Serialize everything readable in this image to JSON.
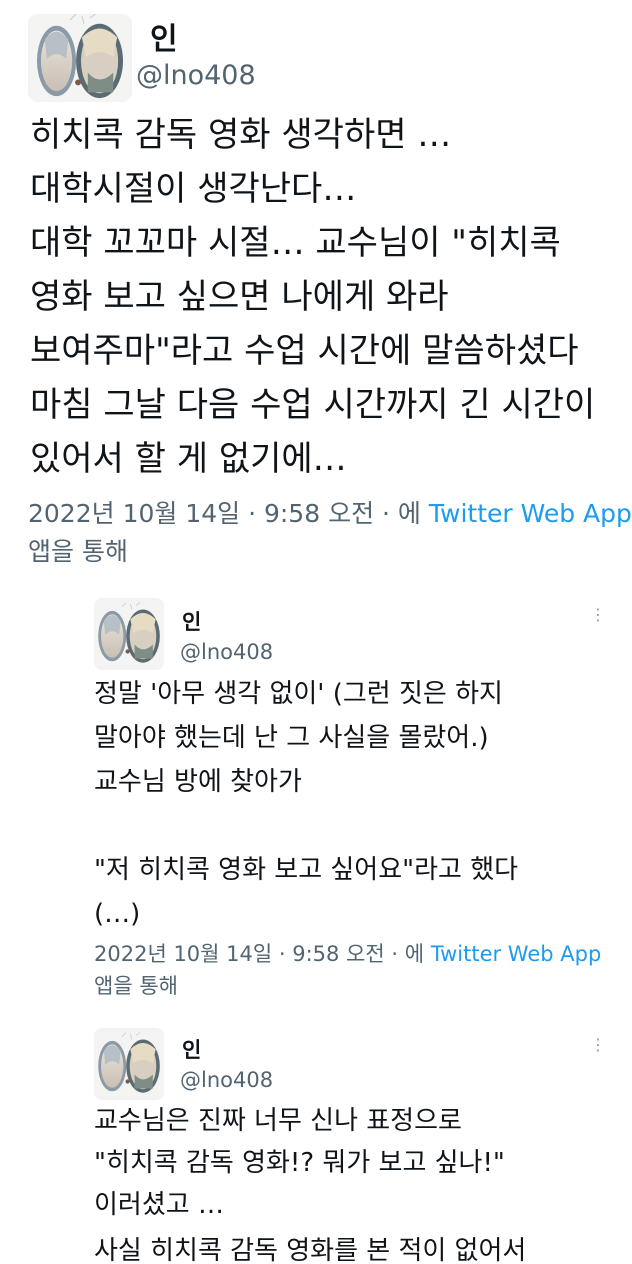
{
  "main_tweet": {
    "name": "인",
    "handle": "@lno408",
    "lines": [
      "히치콕 감독 영화 생각하면 …",
      "대학시절이 생각난다…",
      "대학 꼬꼬마 시절… 교수님이 \"히치콕",
      "영화 보고 싶으면 나에게 와라",
      "보여주마\"라고 수업 시간에 말씀하셨다",
      "마침 그날 다음 수업 시간까지 긴 시간이",
      "있어서 할 게 없기에…"
    ],
    "timestamp": "2022년 10월 14일 · 9:58 오전 · 에",
    "source": "Twitter Web App",
    "via": "앱을 통해"
  },
  "reply1": {
    "name": "인",
    "handle": "@lno408",
    "more": "⋮",
    "lines": [
      "정말 '아무 생각 없이' (그런 짓은 하지",
      "말아야 했는데 난 그 사실을 몰랐어.)",
      "교수님 방에 찾아가",
      "",
      "\"저 히치콕 영화 보고 싶어요\"라고 했다",
      "(…)"
    ],
    "timestamp": "2022년 10월 14일 · 9:58 오전 · 에",
    "source": "Twitter Web App",
    "via": "앱을 통해"
  },
  "reply2": {
    "name": "인",
    "handle": "@lno408",
    "more": "⋮",
    "lines": [
      "교수님은 진짜 너무 신나 표정으로",
      "\"히치콕 감독 영화!? 뭐가 보고 싶나!\"",
      "이러셨고 …",
      "사실 히치콕 감독 영화를 본 적이 없어서"
    ]
  },
  "colors": {
    "text": "#0f1419",
    "muted": "#536471",
    "link": "#1d9bf0",
    "background": "#ffffff"
  },
  "icons": {
    "avatar": "profile-picture-illustration",
    "more": "vertical-ellipsis-icon"
  }
}
